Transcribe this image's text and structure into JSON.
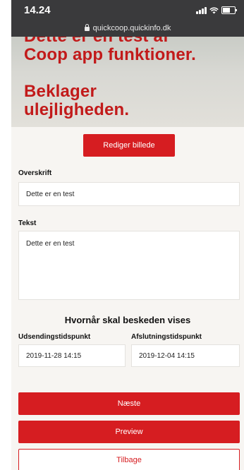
{
  "status_bar": {
    "time": "14.24"
  },
  "browser": {
    "url": "quickcoop.quickinfo.dk"
  },
  "image": {
    "lines": [
      "Dette er en test af",
      "Coop app funktioner.",
      "Beklager",
      "ulejligheden."
    ]
  },
  "edit_image_label": "Rediger billede",
  "heading_field": {
    "label": "Overskrift",
    "value": "Dette er en test"
  },
  "text_field": {
    "label": "Tekst",
    "value": "Dette er en test"
  },
  "schedule": {
    "title": "Hvornår skal beskeden vises",
    "start_label": "Udsendingstidspunkt",
    "start_value": "2019-11-28 14:15",
    "end_label": "Afslutningstidspunkt",
    "end_value": "2019-12-04 14:15"
  },
  "buttons": {
    "next": "Næste",
    "preview": "Preview",
    "back": "Tilbage"
  },
  "colors": {
    "accent": "#d61d21",
    "status_bar": "#3a3a3c"
  }
}
